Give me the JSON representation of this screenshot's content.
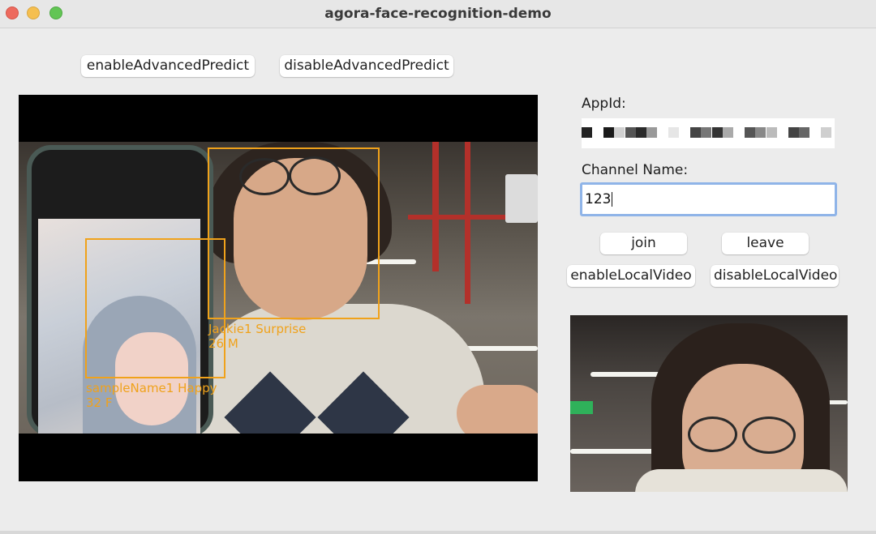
{
  "window": {
    "title": "agora-face-recognition-demo"
  },
  "toolbar": {
    "enable_advanced_predict": "enableAdvancedPredict",
    "disable_advanced_predict": "disableAdvancedPredict"
  },
  "form": {
    "appid_label": "AppId:",
    "appid_value_redacted": true,
    "channel_label": "Channel Name:",
    "channel_value": "123"
  },
  "buttons": {
    "join": "join",
    "leave": "leave",
    "enable_local_video": "enableLocalVideo",
    "disable_local_video": "disableLocalVideo"
  },
  "detections": [
    {
      "name_emotion": "Jackie1 Surprise",
      "age_gender": "26 M"
    },
    {
      "name_emotion": "sampleName1 Happy",
      "age_gender": "32 F"
    }
  ],
  "colors": {
    "detection_box": "#f0a21b",
    "focus_ring": "#8fb4e8"
  }
}
